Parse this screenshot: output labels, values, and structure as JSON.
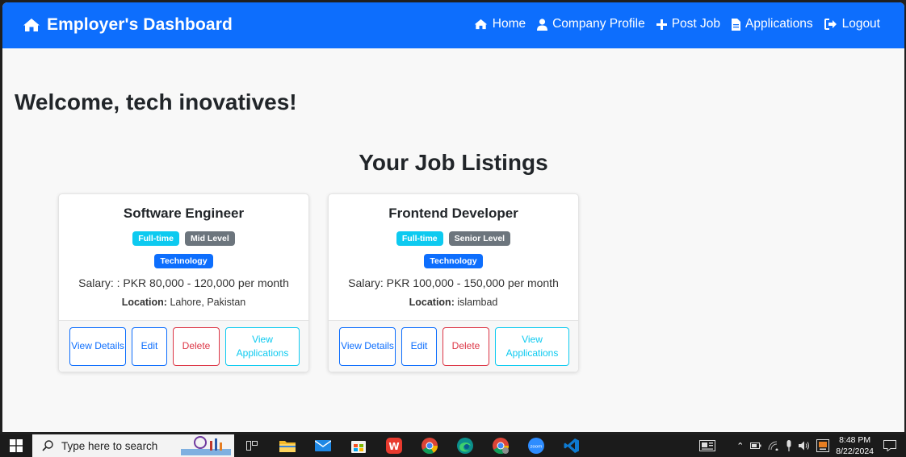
{
  "navbar": {
    "brand": "Employer's Dashboard",
    "links": [
      {
        "label": "Home",
        "icon": "home-icon"
      },
      {
        "label": "Company Profile",
        "icon": "user-icon"
      },
      {
        "label": "Post Job",
        "icon": "plus-icon"
      },
      {
        "label": "Applications",
        "icon": "file-icon"
      },
      {
        "label": "Logout",
        "icon": "logout-icon"
      }
    ]
  },
  "main": {
    "welcome": "Welcome, tech inovatives!",
    "section_title": "Your Job Listings"
  },
  "jobs": [
    {
      "title": "Software Engineer",
      "badges": [
        "Full-time",
        "Mid Level",
        "Technology"
      ],
      "salary": "Salary: : PKR 80,000 - 120,000 per month",
      "location_label": "Location:",
      "location": "Lahore, Pakistan",
      "buttons": {
        "view_details": "View Details",
        "edit": "Edit",
        "delete": "Delete",
        "view_applications": "View Applications"
      }
    },
    {
      "title": "Frontend Developer",
      "badges": [
        "Full-time",
        "Senior Level",
        "Technology"
      ],
      "salary": "Salary: PKR 100,000 - 150,000 per month",
      "location_label": "Location:",
      "location": "islambad",
      "buttons": {
        "view_details": "View Details",
        "edit": "Edit",
        "delete": "Delete",
        "view_applications": "View Applications"
      }
    }
  ],
  "taskbar": {
    "search_placeholder": "Type here to search",
    "time": "8:48 PM",
    "date": "8/22/2024"
  },
  "colors": {
    "primary": "#0d6efd",
    "info": "#0dcaf0",
    "secondary": "#6c757d",
    "danger": "#dc3545"
  }
}
